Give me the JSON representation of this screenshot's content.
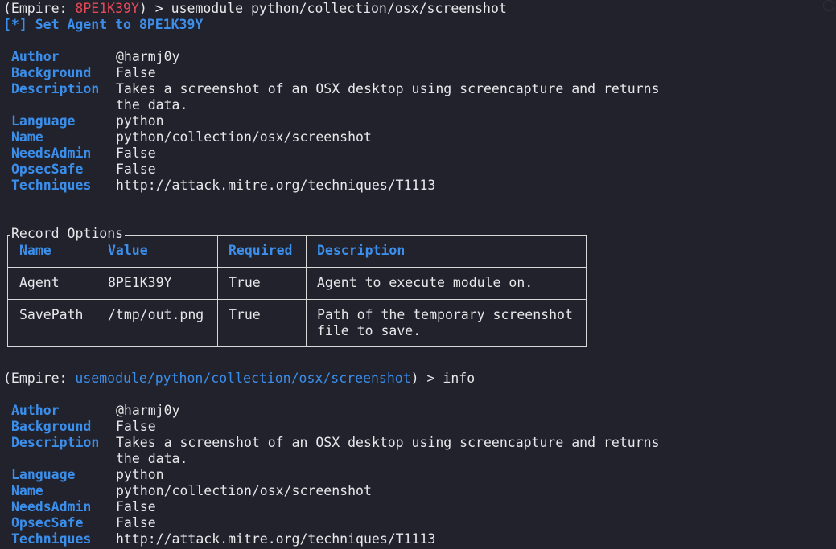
{
  "prompt1": {
    "open_paren": "(Empire: ",
    "agent": "8PE1K39Y",
    "close": ") > ",
    "command": "usemodule python/collection/osx/screenshot"
  },
  "set_agent_msg": "[*] Set Agent to 8PE1K39Y",
  "info1": [
    {
      "key": "Author",
      "value": "@harmj0y"
    },
    {
      "key": "Background",
      "value": "False"
    },
    {
      "key": "Description",
      "value": "Takes a screenshot of an OSX desktop using screencapture and returns"
    },
    {
      "key": "",
      "value": "the data."
    },
    {
      "key": "Language",
      "value": "python"
    },
    {
      "key": "Name",
      "value": "python/collection/osx/screenshot"
    },
    {
      "key": "NeedsAdmin",
      "value": "False"
    },
    {
      "key": "OpsecSafe",
      "value": "False"
    },
    {
      "key": "Techniques",
      "value": "http://attack.mitre.org/techniques/T1113"
    }
  ],
  "options_table": {
    "title": "Record Options",
    "headers": [
      "Name",
      "Value",
      "Required",
      "Description"
    ],
    "rows": [
      {
        "name": "Agent",
        "value": "8PE1K39Y",
        "required": "True",
        "description": [
          "Agent to execute module on."
        ]
      },
      {
        "name": "SavePath",
        "value": "/tmp/out.png",
        "required": "True",
        "description": [
          "Path of the temporary screenshot",
          "file to save."
        ]
      }
    ]
  },
  "prompt2": {
    "open_paren": "(Empire: ",
    "module": "usemodule/python/collection/osx/screenshot",
    "close": ") > ",
    "command": "info"
  },
  "info2": [
    {
      "key": "Author",
      "value": "@harmj0y"
    },
    {
      "key": "Background",
      "value": "False"
    },
    {
      "key": "Description",
      "value": "Takes a screenshot of an OSX desktop using screencapture and returns"
    },
    {
      "key": "",
      "value": "the data."
    },
    {
      "key": "Language",
      "value": "python"
    },
    {
      "key": "Name",
      "value": "python/collection/osx/screenshot"
    },
    {
      "key": "NeedsAdmin",
      "value": "False"
    },
    {
      "key": "OpsecSafe",
      "value": "False"
    },
    {
      "key": "Techniques",
      "value": "http://attack.mitre.org/techniques/T1113"
    }
  ],
  "colors": {
    "background": "#21222c",
    "foreground": "#e8e8ea",
    "key_blue": "#3b8eea",
    "agent_red": "#e74856"
  }
}
